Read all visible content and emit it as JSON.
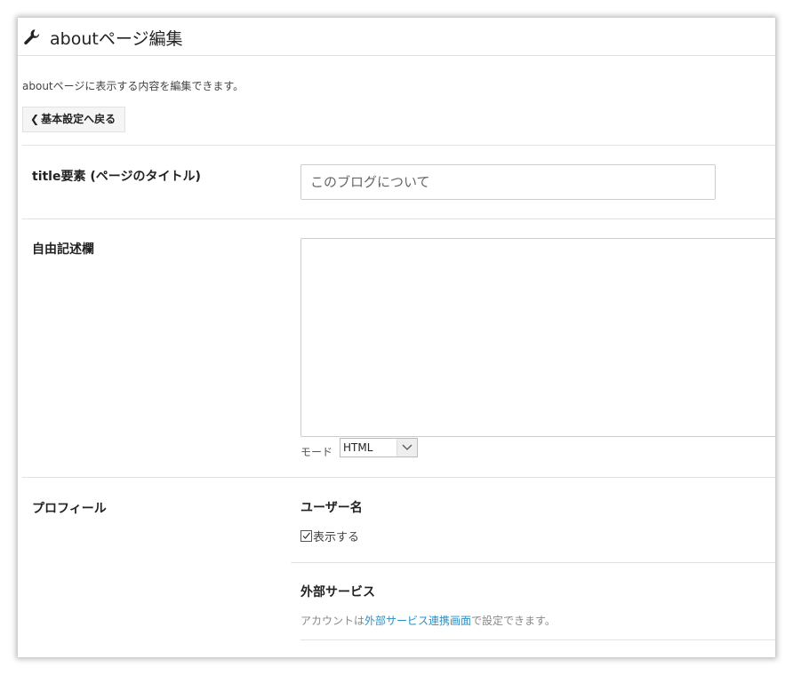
{
  "header": {
    "title": "aboutページ編集",
    "icon": "wrench-icon"
  },
  "description": "aboutページに表示する内容を編集できます。",
  "back_button": {
    "label": "基本設定へ戻る",
    "icon": "chevron-left-icon"
  },
  "title_field": {
    "label": "title要素 (ページのタイトル)",
    "placeholder": "このブログについて"
  },
  "free_text": {
    "label": "自由記述欄",
    "value": "",
    "mode_label": "モード",
    "mode_value": "HTML"
  },
  "profile": {
    "label": "プロフィール",
    "username": {
      "label": "ユーザー名",
      "checkbox_label": "表示する",
      "checked": true
    },
    "external": {
      "label": "外部サービス",
      "note_prefix": "アカウントは",
      "link_text": "外部サービス連携画面",
      "note_suffix": "で設定できます。",
      "link_color": "#2a8fc5"
    }
  }
}
